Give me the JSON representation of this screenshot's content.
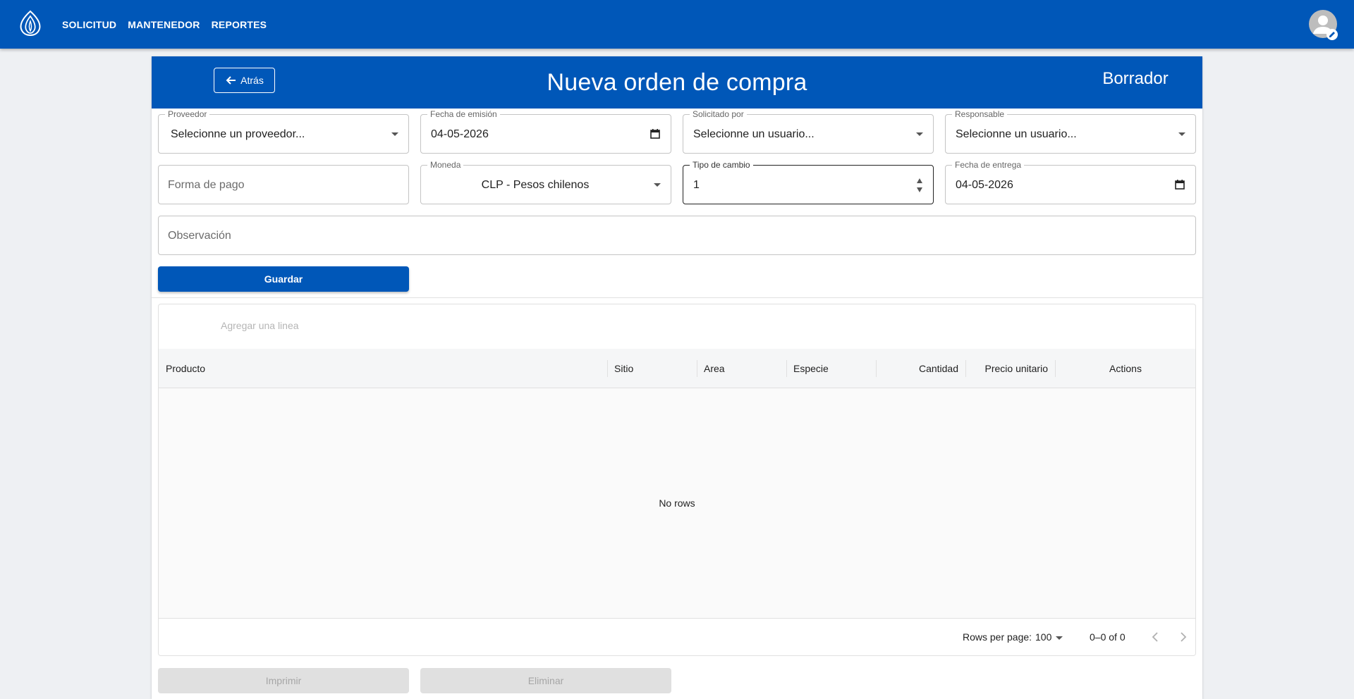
{
  "nav": {
    "items": [
      {
        "label": "SOLICITUD"
      },
      {
        "label": "MANTENEDOR"
      },
      {
        "label": "REPORTES"
      }
    ]
  },
  "header": {
    "back_label": "Atrás",
    "title": "Nueva orden de compra",
    "status": "Borrador"
  },
  "form": {
    "proveedor": {
      "label": "Proveedor",
      "value": "Selecionne un proveedor..."
    },
    "fecha_emision": {
      "label": "Fecha de emisión",
      "value": "04-05-2026"
    },
    "solicitado_por": {
      "label": "Solicitado por",
      "value": "Selecionne un usuario..."
    },
    "responsable": {
      "label": "Responsable",
      "value": "Selecionne un usuario..."
    },
    "forma_pago": {
      "placeholder": "Forma de pago"
    },
    "moneda": {
      "label": "Moneda",
      "value": "CLP - Pesos chilenos"
    },
    "tipo_cambio": {
      "label": "Tipo de cambio",
      "value": "1"
    },
    "fecha_entrega": {
      "label": "Fecha de entrega",
      "value": "04-05-2026"
    },
    "observacion": {
      "placeholder": "Observación"
    },
    "save_label": "Guardar"
  },
  "grid": {
    "add_line_label": "Agregar una linea",
    "columns": [
      "Producto",
      "Sitio",
      "Area",
      "Especie",
      "Cantidad",
      "Precio unitario",
      "Actions"
    ],
    "empty_text": "No rows",
    "rows_per_page_label": "Rows per page:",
    "rows_per_page": "100",
    "page_info": "0–0 of 0"
  },
  "actions": {
    "print_label": "Imprimir",
    "delete_label": "Eliminar"
  },
  "colors": {
    "primary": "#0057b8",
    "disabled_bg": "#e0e0e0",
    "disabled_text": "#a6a6a6"
  }
}
